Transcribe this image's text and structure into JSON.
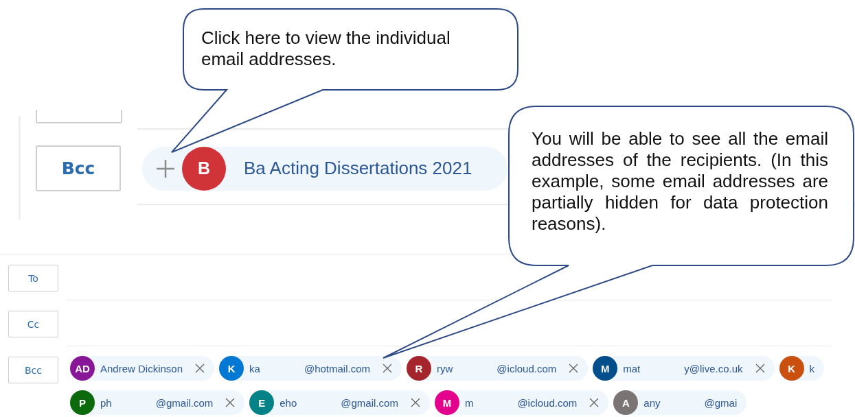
{
  "callouts": [
    {
      "text": "Click here to view the individual email addresses."
    },
    {
      "text": "You will be able to see all the email addresses of the recipients. (In this example, some email addresses are partially hidden for data protection reasons)."
    }
  ],
  "zoomed_view": {
    "field_label": "Bcc",
    "group_chip": {
      "initial": "B",
      "name": "Ba Acting Dissertations 2021",
      "color": "#d13438"
    }
  },
  "compose": {
    "fields": [
      {
        "label": "To"
      },
      {
        "label": "Cc"
      },
      {
        "label": "Bcc",
        "recipient_rows": [
          [
            {
              "initials": "AD",
              "color": "#881798",
              "lead": "Andrew Dickinson",
              "removable": true
            },
            {
              "initials": "K",
              "color": "#0078d4",
              "lead": "ka",
              "tail": "@hotmail.com",
              "removable": true
            },
            {
              "initials": "R",
              "color": "#a4262c",
              "lead": "ryw",
              "tail": "@icloud.com",
              "removable": true
            },
            {
              "initials": "M",
              "color": "#004e8c",
              "lead": "mat",
              "tail": "y@live.co.uk",
              "removable": true
            },
            {
              "initials": "K",
              "color": "#ca5010",
              "lead": "k",
              "removable": false
            }
          ],
          [
            {
              "initials": "P",
              "color": "#0b6a0b",
              "lead": "ph",
              "tail": "@gmail.com",
              "removable": true
            },
            {
              "initials": "E",
              "color": "#038387",
              "lead": "eho",
              "tail": "@gmail.com",
              "removable": true
            },
            {
              "initials": "M",
              "color": "#e3008c",
              "lead": "m",
              "tail": "@icloud.com",
              "removable": true
            },
            {
              "initials": "A",
              "color": "#7a7574",
              "lead": "any",
              "tail": "@gmai",
              "removable": false
            }
          ]
        ]
      }
    ]
  }
}
